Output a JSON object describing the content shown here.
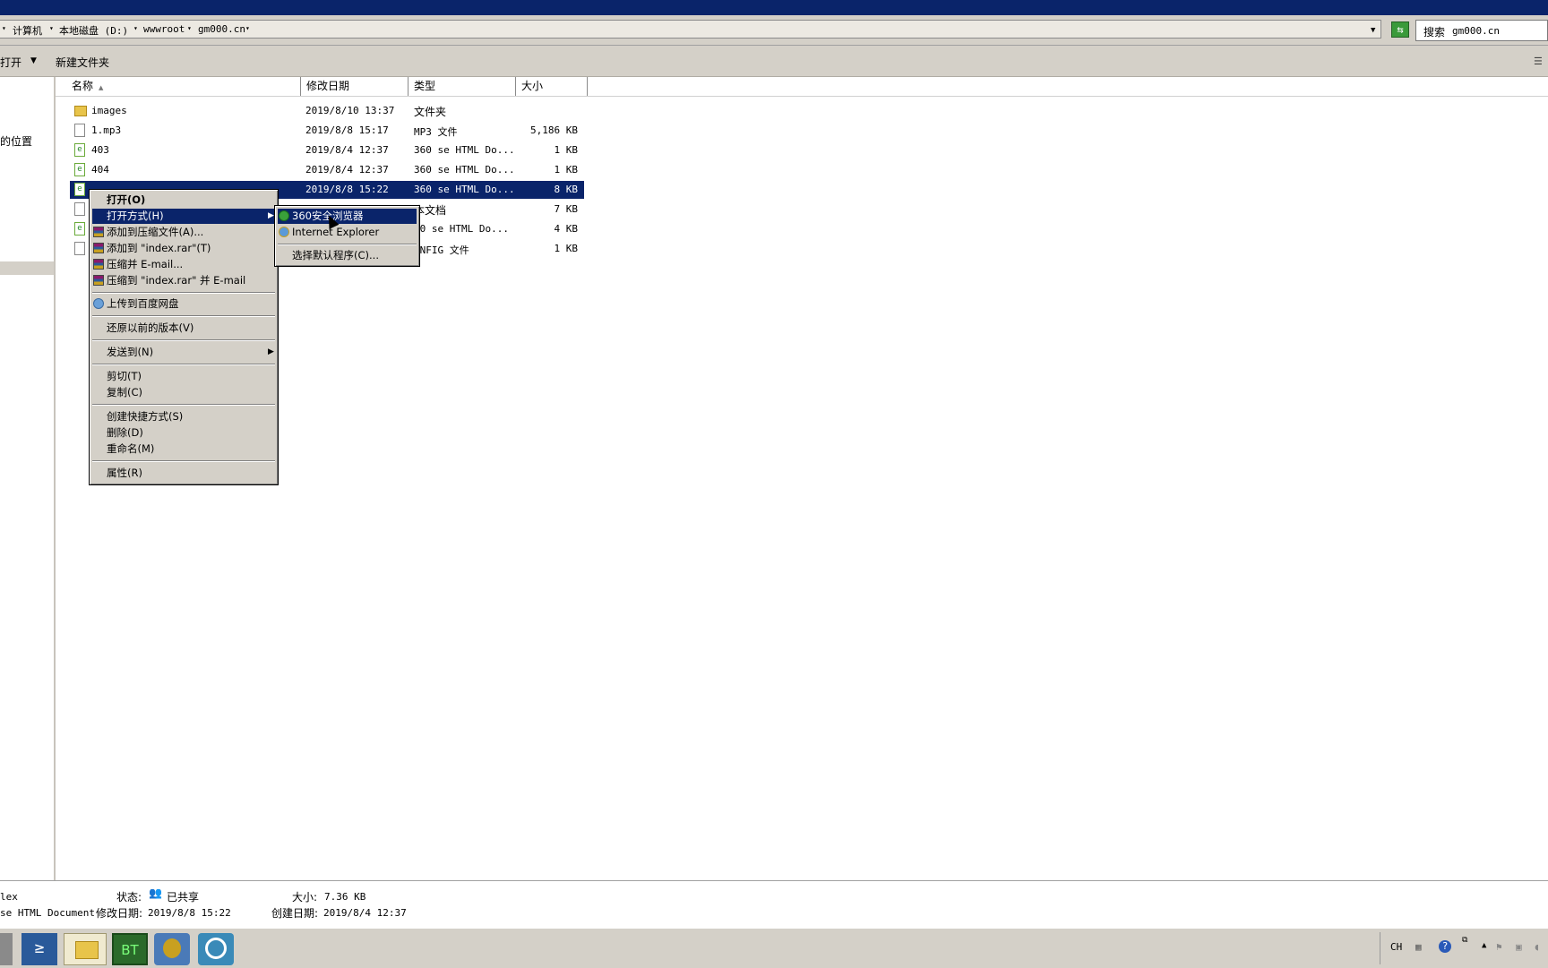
{
  "address": {
    "breadcrumbs": [
      "计算机",
      "本地磁盘 (D:)",
      "wwwroot",
      "gm000.cn"
    ],
    "search_label": "搜索",
    "search_text": "gm000.cn"
  },
  "toolbar": {
    "open_label": "打开",
    "new_folder_label": "新建文件夹"
  },
  "nav": {
    "recent_places": "的位置"
  },
  "columns": {
    "name": "名称",
    "modified": "修改日期",
    "type": "类型",
    "size": "大小"
  },
  "files": [
    {
      "name": "images",
      "modified": "2019/8/10 13:37",
      "type": "文件夹",
      "size": "",
      "icon": "folder-icon"
    },
    {
      "name": "1.mp3",
      "modified": "2019/8/8 15:17",
      "type": "MP3 文件",
      "size": "5,186 KB",
      "icon": "file-icon"
    },
    {
      "name": "403",
      "modified": "2019/8/4 12:37",
      "type": "360 se HTML Do...",
      "size": "1 KB",
      "icon": "html-icon"
    },
    {
      "name": "404",
      "modified": "2019/8/4 12:37",
      "type": "360 se HTML Do...",
      "size": "1 KB",
      "icon": "html-icon"
    },
    {
      "name": "",
      "modified": "2019/8/8 15:22",
      "type": "360 se HTML Do...",
      "size": "8 KB",
      "icon": "html-icon",
      "selected": true
    },
    {
      "name": "",
      "modified": "",
      "type": "本文档",
      "size": "7 KB",
      "icon": "file-icon"
    },
    {
      "name": "",
      "modified": "",
      "type": "50 se HTML Do...",
      "size": "4 KB",
      "icon": "html-icon"
    },
    {
      "name": "",
      "modified": "",
      "type": "ONFIG 文件",
      "size": "1 KB",
      "icon": "file-icon"
    }
  ],
  "context_menu": {
    "open": "打开(O)",
    "open_with": "打开方式(H)",
    "add_archive": "添加到压缩文件(A)...",
    "add_index_rar": "添加到 \"index.rar\"(T)",
    "compress_email": "压缩并 E-mail...",
    "compress_index_email": "压缩到 \"index.rar\" 并 E-mail",
    "upload_baidu": "上传到百度网盘",
    "restore_versions": "还原以前的版本(V)",
    "send_to": "发送到(N)",
    "cut": "剪切(T)",
    "copy": "复制(C)",
    "create_shortcut": "创建快捷方式(S)",
    "delete": "删除(D)",
    "rename": "重命名(M)",
    "properties": "属性(R)"
  },
  "submenu": {
    "browser_360": "360安全浏览器",
    "ie": "Internet Explorer",
    "choose_default": "选择默认程序(C)..."
  },
  "details": {
    "name_partial": "lex",
    "type_partial": "se HTML Document",
    "status_label": "状态:",
    "status_value": "已共享",
    "size_label": "大小:",
    "size_value": "7.36 KB",
    "modified_label": "修改日期:",
    "modified_value": "2019/8/8 15:22",
    "created_label": "创建日期:",
    "created_value": "2019/8/4 12:37"
  },
  "taskbar": {
    "bt_label": "BT",
    "lang": "CH"
  }
}
